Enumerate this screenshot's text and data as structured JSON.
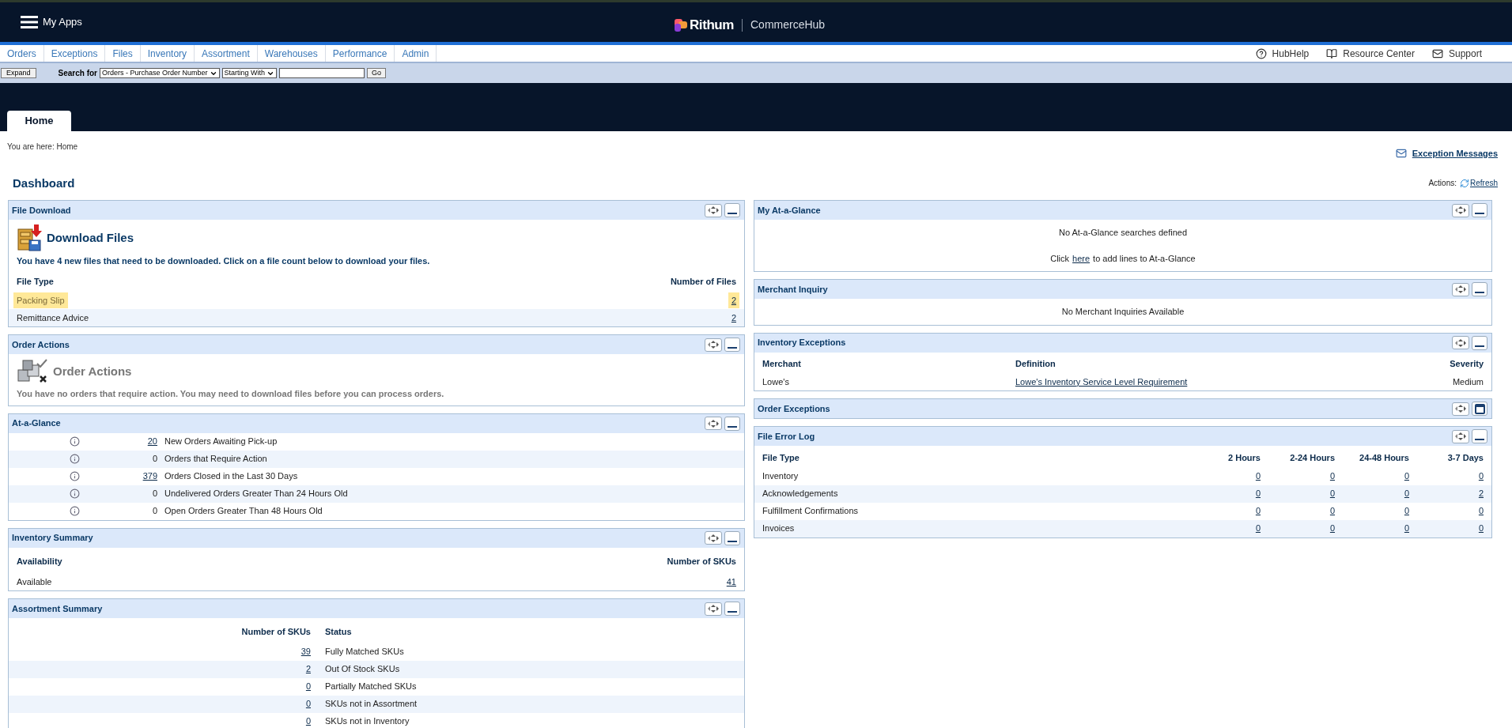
{
  "header": {
    "menu_label": "My Apps",
    "brand": "Rithum",
    "product": "CommerceHub"
  },
  "nav": {
    "items": [
      "Orders",
      "Exceptions",
      "Files",
      "Inventory",
      "Assortment",
      "Warehouses",
      "Performance",
      "Admin"
    ],
    "help_links": [
      {
        "label": "HubHelp",
        "kind": "help"
      },
      {
        "label": "Resource Center",
        "kind": "book"
      },
      {
        "label": "Support",
        "kind": "mail"
      }
    ]
  },
  "search_bar": {
    "expand_button": "Expand",
    "label": "Search for",
    "search_type": "Orders - Purchase Order Number",
    "match_type": "Starting With",
    "go_button": "Go"
  },
  "tabs": [
    {
      "label": "Home",
      "selected": true
    }
  ],
  "breadcrumb": "You are here: Home",
  "exception_messages": "Exception Messages",
  "title": "Dashboard",
  "actions_label": "Actions:",
  "refresh": "Refresh",
  "left_panels": [
    {
      "kind": "download",
      "title": "File Download",
      "collapsed": false,
      "heading": "Download Files",
      "message": "You have 4 new files that need to be downloaded. Click on a file count below to download your files.",
      "columns": [
        "File Type",
        "Number of Files"
      ],
      "rows": [
        {
          "type": "Packing Slip",
          "count": "2",
          "highlighted": true
        },
        {
          "type": "Remittance Advice",
          "count": "2",
          "highlighted": false
        }
      ]
    },
    {
      "kind": "order_actions",
      "title": "Order Actions",
      "collapsed": false,
      "heading": "Order Actions",
      "message": "You have no orders that require action. You may need to download files before you can process orders."
    },
    {
      "kind": "glance",
      "title": "At-a-Glance",
      "collapsed": false,
      "rows": [
        {
          "count": "20",
          "label": "New Orders Awaiting Pick-up",
          "link": true
        },
        {
          "count": "0",
          "label": "Orders that Require Action",
          "link": false
        },
        {
          "count": "379",
          "label": "Orders Closed in the Last 30 Days",
          "link": true
        },
        {
          "count": "0",
          "label": "Undelivered Orders Greater Than 24 Hours Old",
          "link": false
        },
        {
          "count": "0",
          "label": "Open Orders Greater Than 48 Hours Old",
          "link": false
        }
      ]
    },
    {
      "kind": "inventory",
      "title": "Inventory Summary",
      "collapsed": false,
      "columns": [
        "Availability",
        "Number of SKUs"
      ],
      "rows": [
        {
          "availability": "Available",
          "count": "41"
        }
      ]
    },
    {
      "kind": "assortment",
      "title": "Assortment Summary",
      "collapsed": false,
      "columns": [
        "Number of SKUs",
        "Status"
      ],
      "rows": [
        {
          "count": "39",
          "status": "Fully Matched SKUs"
        },
        {
          "count": "2",
          "status": "Out Of Stock SKUs"
        },
        {
          "count": "0",
          "status": "Partially Matched SKUs"
        },
        {
          "count": "0",
          "status": "SKUs not in Assortment"
        },
        {
          "count": "0",
          "status": "SKUs not in Inventory"
        }
      ]
    }
  ],
  "right_panels": [
    {
      "kind": "message",
      "title": "My At-a-Glance",
      "collapsed": false,
      "message": "No At-a-Glance searches defined",
      "link_prefix": "Click",
      "link": "here",
      "link_suffix": "to add lines to At-a-Glance"
    },
    {
      "kind": "merchant",
      "title": "Merchant Inquiry",
      "collapsed": false,
      "message": "No Merchant Inquiries Available"
    },
    {
      "kind": "inv_exceptions",
      "title": "Inventory Exceptions",
      "collapsed": false,
      "columns": [
        "Merchant",
        "Definition",
        "Severity"
      ],
      "rows": [
        {
          "merchant": "Lowe's",
          "definition": "Lowe's Inventory Service Level Requirement",
          "severity": "Medium"
        }
      ]
    },
    {
      "title": "Order Exceptions",
      "collapsed": true
    },
    {
      "kind": "error_log",
      "title": "File Error Log",
      "collapsed": false,
      "columns": [
        "File Type",
        "2 Hours",
        "2-24 Hours",
        "24-48 Hours",
        "3-7 Days"
      ],
      "rows": [
        {
          "type": "Inventory",
          "values": [
            "0",
            "0",
            "0",
            "0"
          ]
        },
        {
          "type": "Acknowledgements",
          "values": [
            "0",
            "0",
            "0",
            "2"
          ]
        },
        {
          "type": "Fulfillment Confirmations",
          "values": [
            "0",
            "0",
            "0",
            "0"
          ]
        },
        {
          "type": "Invoices",
          "values": [
            "0",
            "0",
            "0",
            "0"
          ]
        }
      ]
    }
  ]
}
